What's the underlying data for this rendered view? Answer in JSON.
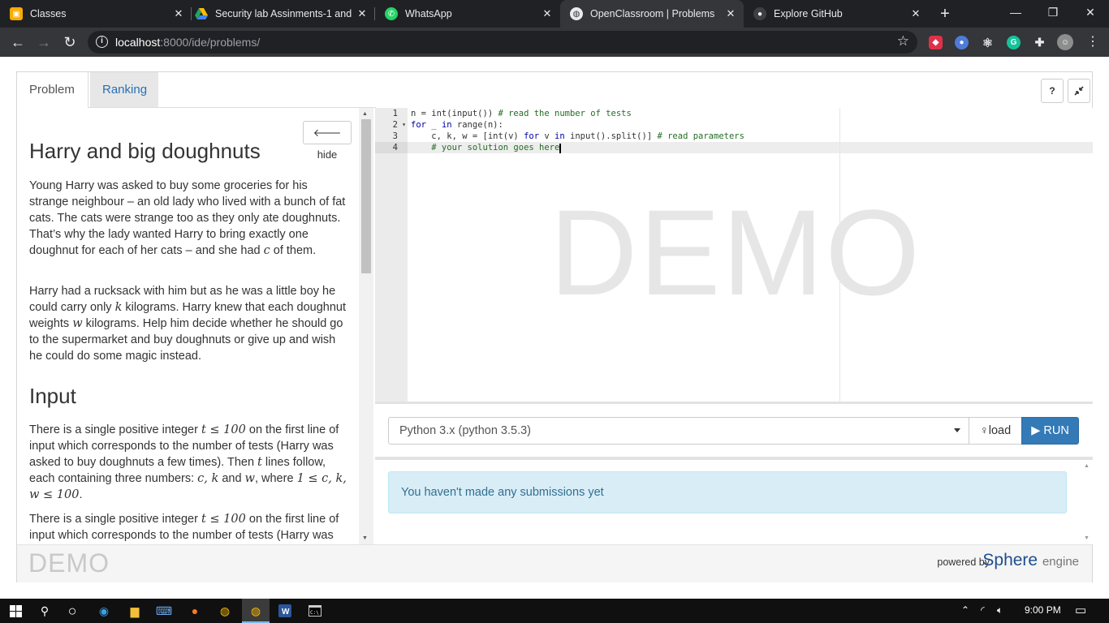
{
  "browser": {
    "tabs": [
      {
        "title": "Classes",
        "favicon": "google-classroom-icon",
        "color": "#f9ab00"
      },
      {
        "title": "Security lab Assinments-1 and",
        "favicon": "google-drive-icon",
        "color": "#1fa463"
      },
      {
        "title": "WhatsApp",
        "favicon": "whatsapp-icon",
        "color": "#25d366"
      },
      {
        "title": "OpenClassroom | Problems",
        "favicon": "globe-icon",
        "color": "#e8eaed"
      },
      {
        "title": "Explore GitHub",
        "favicon": "github-icon",
        "color": "#24292e"
      }
    ],
    "url_host": "localhost",
    "url_path": ":8000/ide/problems/"
  },
  "app": {
    "tabs": {
      "problem": "Problem",
      "ranking": "Ranking"
    },
    "help_label": "?",
    "hide_label": "hide",
    "problem": {
      "title": "Harry and big doughnuts",
      "p1a": "Young Harry was asked to buy some groceries for his strange neighbour – an old lady who lived with a bunch of fat cats. The cats were strange too as they only ate doughnuts. That’s why the lady wanted Harry to bring exactly one doughnut for each of her cats – and she had ",
      "p1var": "c",
      "p1b": " of them.",
      "p2a": "Harry had a rucksack with him but as he was a little boy he could carry only ",
      "p2k": "k",
      "p2b": " kilograms. Harry knew that each doughnut weights ",
      "p2w": "w",
      "p2c": " kilograms. Help him decide whether he should go to the supermarket and buy doughnuts or give up and wish he could do some magic instead.",
      "input_heading": "Input",
      "i1a": "There is a single positive integer ",
      "i1math": "t ≤ 100",
      "i1b": " on the first line of input which corresponds to the number of tests (Harry was asked to buy doughnuts a few times). Then ",
      "i1t": "t",
      "i1c": " lines follow, each containing three numbers: ",
      "i1vars": "c, k",
      "i1d": " and ",
      "i1w": "w",
      "i1e": ", where ",
      "i1range": "1 ≤ c, k, w ≤ 100",
      "i1f": ".",
      "i2a": "There is a single positive integer ",
      "i2math": "t ≤ 100",
      "i2b": " on the first line of input which corresponds to the number of tests (Harry was"
    },
    "editor": {
      "line_numbers": [
        "1",
        "2",
        "3",
        "4"
      ],
      "watermark": "DEMO",
      "line1_code": "n = int(input()) ",
      "line1_comment": "# read the number of tests",
      "line2_kw1": "for",
      "line2_mid": " _ ",
      "line2_kw2": "in",
      "line2_end": " range(n):",
      "line3_code": "    c, k, w = [int(v) ",
      "line3_kw1": "for",
      "line3_mid": " v ",
      "line3_kw2": "in",
      "line3_end": " input().split()] ",
      "line3_comment": "# read parameters",
      "line4_comment": "    # your solution goes here"
    },
    "language": "Python 3.x (python 3.5.3)",
    "load_label": "load",
    "run_label": "RUN",
    "submissions_message": "You haven't made any submissions yet",
    "footer": {
      "demo": "DEMO",
      "powered_by": "powered by",
      "brand_main": "Sphere",
      "brand_sub": "engine"
    }
  },
  "taskbar": {
    "clock": "9:00 PM"
  }
}
